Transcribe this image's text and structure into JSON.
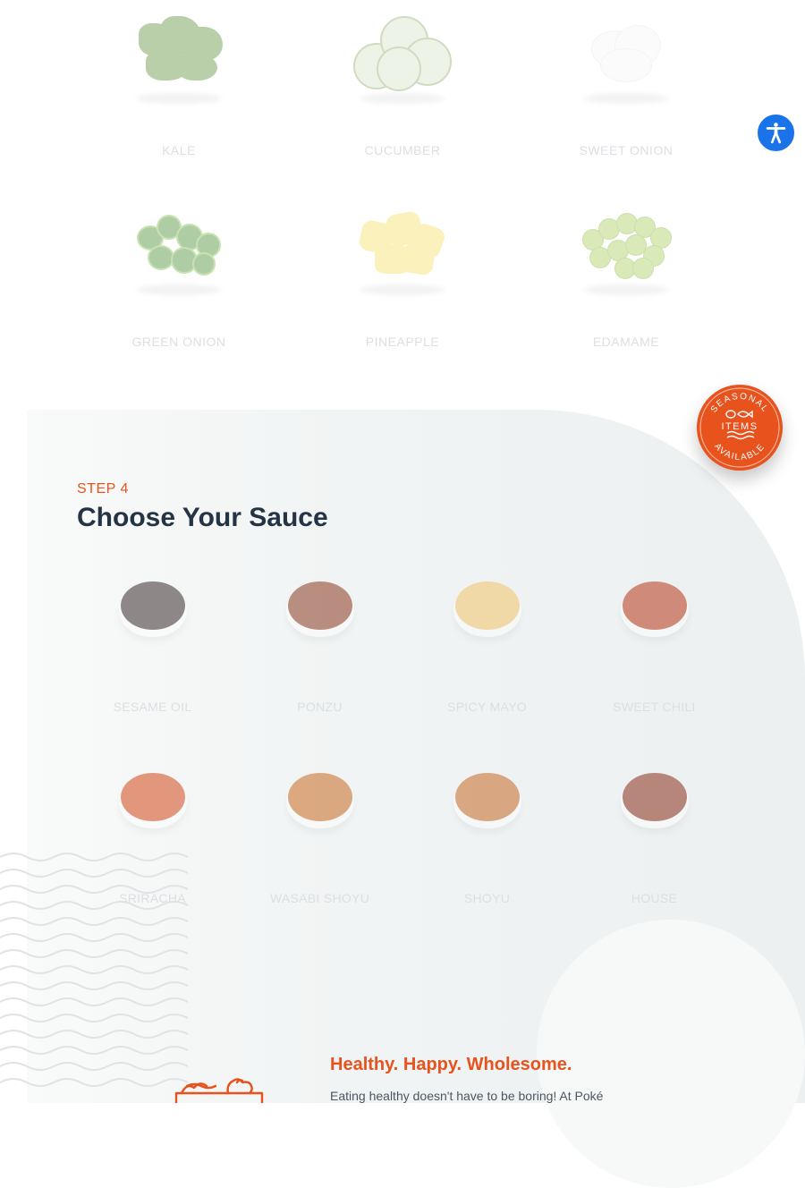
{
  "step3": {
    "row1": [
      {
        "label": "KALE",
        "icon": "kale-icon"
      },
      {
        "label": "CUCUMBER",
        "icon": "cucumber-icon"
      },
      {
        "label": "SWEET ONION",
        "icon": "sweet-onion-icon"
      }
    ],
    "row2": [
      {
        "label": "GREEN ONION",
        "icon": "green-onion-icon"
      },
      {
        "label": "PINEAPPLE",
        "icon": "pineapple-icon"
      },
      {
        "label": "EDAMAME",
        "icon": "edamame-icon"
      }
    ]
  },
  "step4": {
    "step_label": "STEP 4",
    "title": "Choose Your Sauce",
    "sauces": [
      {
        "label": "SESAME OIL",
        "color": "#3a2c2c"
      },
      {
        "label": "PONZU",
        "color": "#8a3a22"
      },
      {
        "label": "SPICY MAYO",
        "color": "#f2c46a"
      },
      {
        "label": "SWEET CHILI",
        "color": "#b8371a"
      },
      {
        "label": "SRIRACHA",
        "color": "#d2491a"
      },
      {
        "label": "WASABI SHOYU",
        "color": "#c96b22"
      },
      {
        "label": "SHOYU",
        "color": "#c76a25"
      },
      {
        "label": "HOUSE",
        "color": "#8a2f1c"
      }
    ]
  },
  "badge": {
    "top_text": "SEASONAL",
    "middle_text": "ITEMS",
    "bottom_text": "AVAILABLE",
    "color": "#e8521c"
  },
  "accessibility": {
    "icon": "accessibility-icon",
    "color": "#1a73e8"
  },
  "promo": {
    "title": "Healthy. Happy. Wholesome.",
    "text": "Eating healthy doesn't have to be boring! At Poké",
    "icon": "poke-bowl-icon",
    "accent": "#e8521c"
  }
}
